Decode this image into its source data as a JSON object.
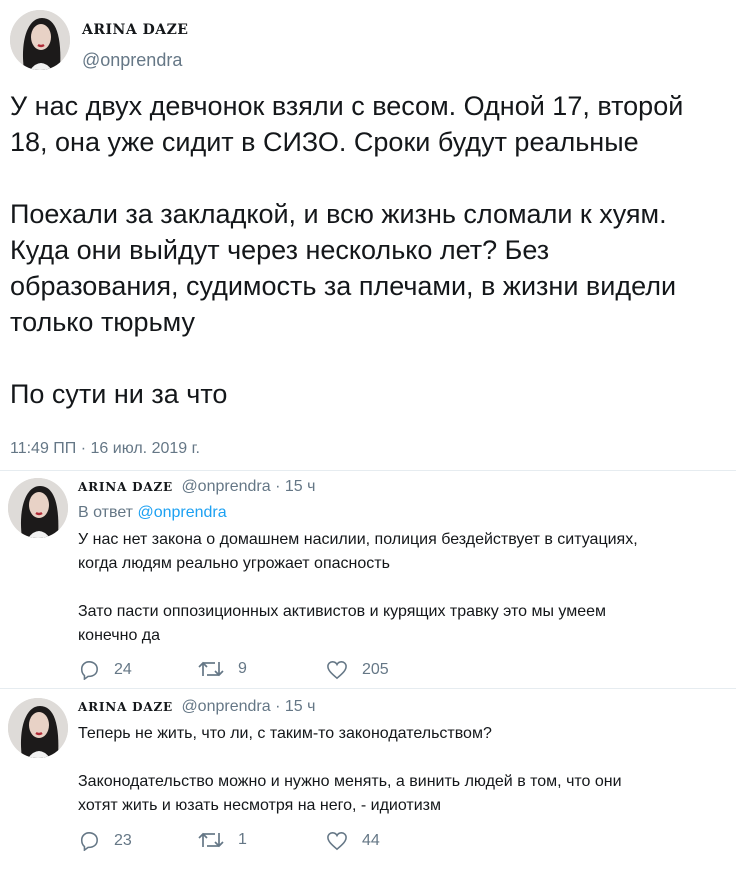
{
  "tweet": {
    "author_name": "ARINA DAZE",
    "author_handle": "@onprendra",
    "text_lines": [
      "У нас двух девчонок взяли с весом. Одной 17, второй",
      "18, она уже сидит в СИЗО. Сроки будут реальные",
      "",
      "Поехали за закладкой, и всю жизнь сломали к хуям.",
      "Куда они выйдут через несколько лет? Без",
      "образования, судимость за плечами, в жизни видели",
      "только тюрьму",
      "",
      "По сути ни за что"
    ],
    "timestamp": "11:49 ПП · 16 июл. 2019 г."
  },
  "replies": [
    {
      "author_name": "ARINA DAZE",
      "author_handle": "@onprendra",
      "time_ago": "· 15 ч",
      "in_reply_prefix": "В ответ",
      "in_reply_handle": "@onprendra",
      "text_lines": [
        "У нас нет закона о домашнем насилии, полиция бездействует в ситуациях,",
        "когда людям реально угрожает опасность",
        "",
        "Зато пасти оппозиционных активистов и курящих травку это мы умеем",
        "конечно да"
      ],
      "replies_count": "24",
      "retweets_count": "9",
      "likes_count": "205"
    },
    {
      "author_name": "ARINA DAZE",
      "author_handle": "@onprendra",
      "time_ago": "· 15 ч",
      "text_lines": [
        "Теперь не жить, что ли, с таким-то законодательством?",
        "",
        "Законодательство можно и нужно менять, а винить людей в том, что они",
        "хотят жить и юзать несмотря на него, - идиотизм"
      ],
      "replies_count": "23",
      "retweets_count": "1",
      "likes_count": "44"
    }
  ],
  "colors": {
    "text": "#14171a",
    "secondary": "#657786",
    "link": "#1da1f2",
    "divider": "#e6ecf0"
  },
  "icons": [
    "reply-icon",
    "retweet-icon",
    "like-icon"
  ]
}
